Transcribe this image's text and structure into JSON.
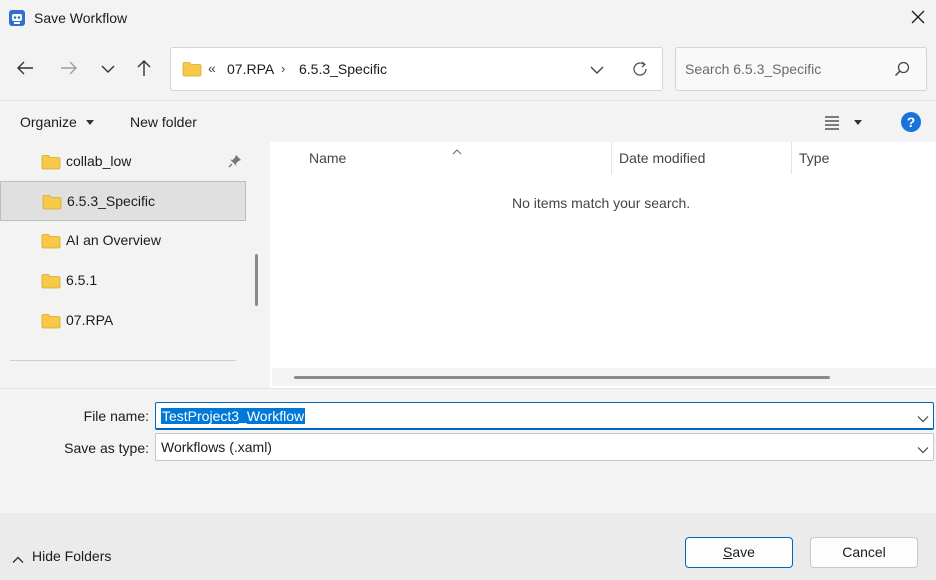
{
  "window": {
    "title": "Save Workflow",
    "close_icon": "close-icon",
    "app_icon": "robot-app-icon"
  },
  "navigation": {
    "back_icon": "arrow-left-icon",
    "forward_icon": "arrow-right-icon",
    "recent_icon": "chevron-down-icon",
    "up_icon": "arrow-up-icon"
  },
  "address_bar": {
    "overflow": "«",
    "crumbs": [
      "07.RPA",
      "6.5.3_Specific"
    ],
    "separator": "›"
  },
  "search": {
    "placeholder": "Search 6.5.3_Specific"
  },
  "toolbar": {
    "organize_label": "Organize",
    "new_folder_label": "New folder",
    "help_label": "?"
  },
  "nav_pane": {
    "items": [
      {
        "label": "collab_low",
        "pinned": true,
        "selected": false
      },
      {
        "label": "6.5.3_Specific",
        "pinned": false,
        "selected": true
      },
      {
        "label": "AI an Overview",
        "pinned": false,
        "selected": false
      },
      {
        "label": "6.5.1",
        "pinned": false,
        "selected": false
      },
      {
        "label": "07.RPA",
        "pinned": false,
        "selected": false
      }
    ]
  },
  "file_list": {
    "columns": [
      "Name",
      "Date modified",
      "Type"
    ],
    "empty_message": "No items match your search."
  },
  "form": {
    "file_name_label": "File name:",
    "file_name_value": "TestProject3_Workflow",
    "save_type_label": "Save as type:",
    "save_type_value": "Workflows (.xaml)"
  },
  "footer": {
    "hide_folders_label": "Hide Folders",
    "save_label": "Save",
    "save_mnemonic": "S",
    "save_rest": "ave",
    "cancel_label": "Cancel"
  },
  "colors": {
    "accent": "#0067c0",
    "selection": "#0078d7",
    "folder": "#f7c948",
    "help": "#1a73d9"
  }
}
